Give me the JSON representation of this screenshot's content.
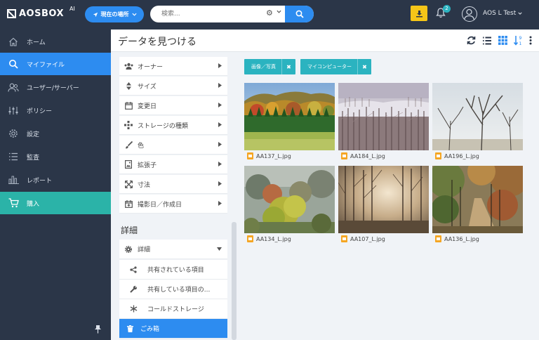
{
  "header": {
    "logo_text": "AOSBOX",
    "logo_ai": "AI",
    "location_button": "現在の場所",
    "search_placeholder": "検索...",
    "notification_count": "2",
    "user_name": "AOS L Test"
  },
  "sidebar": {
    "items": [
      {
        "label": "ホーム",
        "icon": "home-icon"
      },
      {
        "label": "マイファイル",
        "icon": "search-icon"
      },
      {
        "label": "ユーザー/サーバー",
        "icon": "users-icon"
      },
      {
        "label": "ポリシー",
        "icon": "sliders-icon"
      },
      {
        "label": "設定",
        "icon": "gear-icon"
      },
      {
        "label": "監査",
        "icon": "list-icon"
      },
      {
        "label": "レポート",
        "icon": "bar-chart-icon"
      },
      {
        "label": "購入",
        "icon": "cart-icon"
      }
    ]
  },
  "main": {
    "title": "データを見つける"
  },
  "filters": {
    "items": [
      {
        "label": "オーナー",
        "icon": "users-icon"
      },
      {
        "label": "サイズ",
        "icon": "sort-icon"
      },
      {
        "label": "変更日",
        "icon": "calendar-icon"
      },
      {
        "label": "ストレージの種類",
        "icon": "cube-icon"
      },
      {
        "label": "色",
        "icon": "brush-icon"
      },
      {
        "label": "拡張子",
        "icon": "file-image-icon"
      },
      {
        "label": "寸法",
        "icon": "expand-icon"
      },
      {
        "label": "撮影日／作成日",
        "icon": "calendar-plus-icon"
      }
    ],
    "details_title": "詳細",
    "details": [
      {
        "label": "詳細",
        "icon": "gear-icon"
      },
      {
        "label": "共有されている項目",
        "icon": "share-icon"
      },
      {
        "label": "共有している項目の...",
        "icon": "wrench-icon"
      },
      {
        "label": "コールドストレージ",
        "icon": "snowflake-icon"
      },
      {
        "label": "ごみ箱",
        "icon": "trash-icon"
      }
    ]
  },
  "tags": [
    {
      "label": "画像／写真"
    },
    {
      "label": "マイコンピューター"
    }
  ],
  "files": [
    {
      "name": "AA137_L.jpg"
    },
    {
      "name": "AA184_L.jpg"
    },
    {
      "name": "AA196_L.jpg"
    },
    {
      "name": "AA134_L.jpg"
    },
    {
      "name": "AA107_L.jpg"
    },
    {
      "name": "AA136_L.jpg"
    }
  ],
  "colors": {
    "nav_bg": "#2b3648",
    "accent_blue": "#2d8cf0",
    "accent_teal": "#2bb3c0",
    "purchase_teal": "#2bb3a8",
    "download_yellow": "#f5c518"
  }
}
